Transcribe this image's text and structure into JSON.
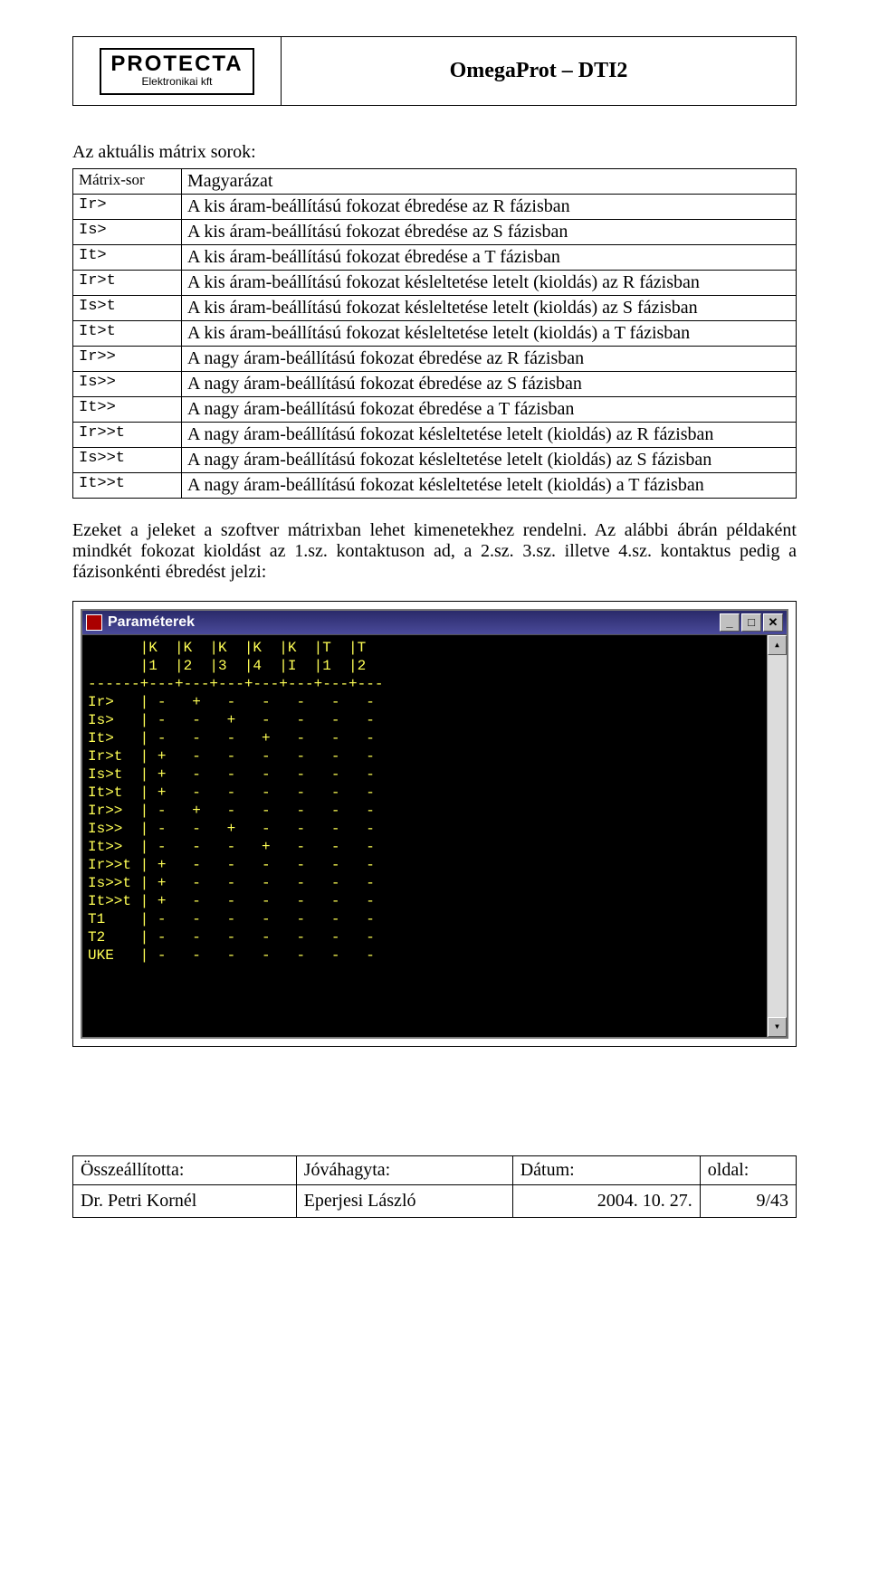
{
  "header": {
    "logo_main": "PROTECTA",
    "logo_sub": "Elektronikai kft",
    "title": "OmegaProt – DTI2"
  },
  "section_title": "Az aktuális mátrix sorok:",
  "table": {
    "head_col1": "Mátrix-sor",
    "head_col2": "Magyarázat",
    "rows": [
      {
        "code": "Ir>",
        "desc": "A kis áram-beállítású fokozat ébredése az R fázisban"
      },
      {
        "code": "Is>",
        "desc": "A kis áram-beállítású fokozat ébredése az S fázisban"
      },
      {
        "code": "It>",
        "desc": "A kis áram-beállítású fokozat ébredése a   T fázisban"
      },
      {
        "code": "Ir>t",
        "desc": "A kis áram-beállítású fokozat késleltetése letelt (kioldás) az R fázisban"
      },
      {
        "code": "Is>t",
        "desc": "A kis áram-beállítású fokozat késleltetése letelt (kioldás) az S fázisban"
      },
      {
        "code": "It>t",
        "desc": "A kis áram-beállítású fokozat késleltetése letelt (kioldás) a   T fázisban"
      },
      {
        "code": "Ir>>",
        "desc": "A nagy áram-beállítású fokozat ébredése az R fázisban"
      },
      {
        "code": "Is>>",
        "desc": "A nagy áram-beállítású fokozat ébredése az S fázisban"
      },
      {
        "code": "It>>",
        "desc": "A nagy áram-beállítású fokozat ébredése a   T fázisban"
      },
      {
        "code": "Ir>>t",
        "desc": "A nagy áram-beállítású fokozat késleltetése letelt (kioldás) az R fázisban"
      },
      {
        "code": "Is>>t",
        "desc": "A nagy áram-beállítású fokozat késleltetése letelt (kioldás) az S fázisban"
      },
      {
        "code": "It>>t",
        "desc": "A nagy áram-beállítású fokozat késleltetése letelt (kioldás) a   T fázisban"
      }
    ]
  },
  "paragraph": "Ezeket a jeleket a szoftver mátrixban lehet kimenetekhez rendelni. Az alábbi ábrán példaként mindkét fokozat kioldást az 1.sz. kontaktuson ad, a 2.sz. 3.sz. illetve 4.sz. kontaktus pedig a fázisonkénti ébredést jelzi:",
  "window": {
    "title": "Paraméterek",
    "btn_min": "_",
    "btn_max": "□",
    "btn_close": "✕",
    "scroll_up": "▴",
    "scroll_down": "▾",
    "term": "      |K  |K  |K  |K  |K  |T  |T\n      |1  |2  |3  |4  |I  |1  |2\n------+---+---+---+---+---+---+---\nIr>   | -   +   -   -   -   -   -\nIs>   | -   -   +   -   -   -   -\nIt>   | -   -   -   +   -   -   -\nIr>t  | +   -   -   -   -   -   -\nIs>t  | +   -   -   -   -   -   -\nIt>t  | +   -   -   -   -   -   -\nIr>>  | -   +   -   -   -   -   -\nIs>>  | -   -   +   -   -   -   -\nIt>>  | -   -   -   +   -   -   -\nIr>>t | +   -   -   -   -   -   -\nIs>>t | +   -   -   -   -   -   -\nIt>>t | +   -   -   -   -   -   -\nT1    | -   -   -   -   -   -   -\nT2    | -   -   -   -   -   -   -\nUKE   | -   -   -   -   -   -   -"
  },
  "footer": {
    "h1": "Összeállította:",
    "h2": "Jóváhagyta:",
    "h3": "Dátum:",
    "h4": "oldal:",
    "v1": "Dr. Petri Kornél",
    "v2": "Eperjesi László",
    "v3": "2004. 10. 27.",
    "v4": "9/43"
  }
}
